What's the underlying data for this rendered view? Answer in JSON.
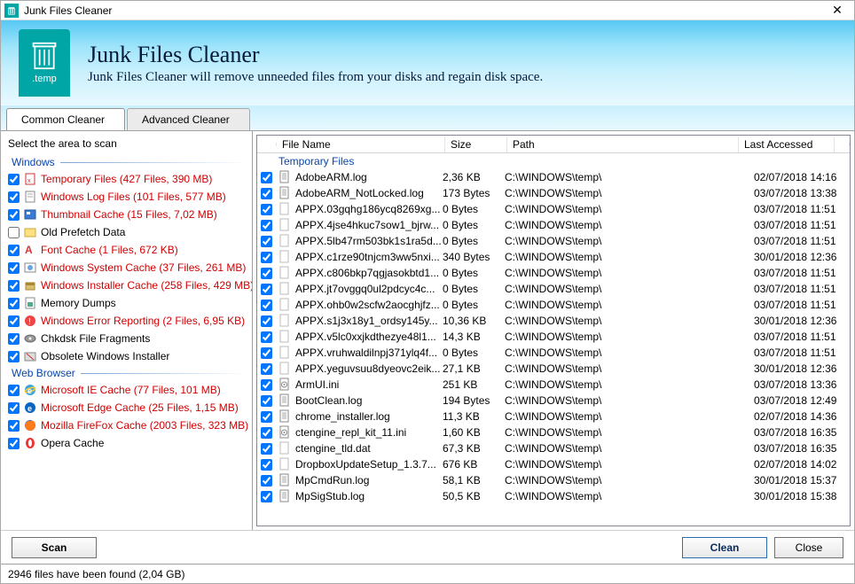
{
  "window": {
    "title": "Junk Files Cleaner"
  },
  "header": {
    "title": "Junk Files Cleaner",
    "subtitle": "Junk Files Cleaner will remove unneeded files from your disks and regain disk space.",
    "ext": ".temp"
  },
  "tabs": [
    {
      "label": "Common Cleaner",
      "active": true
    },
    {
      "label": "Advanced Cleaner",
      "active": false
    }
  ],
  "left": {
    "title": "Select the area to scan",
    "groups": [
      {
        "name": "Windows",
        "items": [
          {
            "label": "Temporary Files (427 Files, 390 MB)",
            "checked": true,
            "red": true,
            "icon": "temp"
          },
          {
            "label": "Windows Log Files (101 Files, 577 MB)",
            "checked": true,
            "red": true,
            "icon": "log"
          },
          {
            "label": "Thumbnail Cache (15 Files, 7,02 MB)",
            "checked": true,
            "red": true,
            "icon": "thumb"
          },
          {
            "label": "Old Prefetch Data",
            "checked": false,
            "red": false,
            "icon": "prefetch"
          },
          {
            "label": "Font Cache (1 Files, 672 KB)",
            "checked": true,
            "red": true,
            "icon": "font"
          },
          {
            "label": "Windows System Cache (37 Files, 261 MB)",
            "checked": true,
            "red": true,
            "icon": "syscache"
          },
          {
            "label": "Windows Installer Cache (258 Files, 429 MB)",
            "checked": true,
            "red": true,
            "icon": "installer"
          },
          {
            "label": "Memory Dumps",
            "checked": true,
            "red": false,
            "icon": "memdump"
          },
          {
            "label": "Windows Error Reporting (2 Files, 6,95 KB)",
            "checked": true,
            "red": true,
            "icon": "error"
          },
          {
            "label": "Chkdsk File Fragments",
            "checked": true,
            "red": false,
            "icon": "chkdsk"
          },
          {
            "label": "Obsolete Windows Installer",
            "checked": true,
            "red": false,
            "icon": "obsolete"
          }
        ]
      },
      {
        "name": "Web Browser",
        "items": [
          {
            "label": "Microsoft IE Cache (77 Files, 101 MB)",
            "checked": true,
            "red": true,
            "icon": "ie"
          },
          {
            "label": "Microsoft Edge Cache (25 Files, 1,15 MB)",
            "checked": true,
            "red": true,
            "icon": "edge"
          },
          {
            "label": "Mozilla FireFox Cache (2003 Files, 323 MB)",
            "checked": true,
            "red": true,
            "icon": "firefox"
          },
          {
            "label": "Opera Cache",
            "checked": true,
            "red": false,
            "icon": "opera"
          }
        ]
      }
    ]
  },
  "table": {
    "columns": {
      "name": "File Name",
      "size": "Size",
      "path": "Path",
      "date": "Last Accessed"
    },
    "group_label": "Temporary Files",
    "rows": [
      {
        "name": "AdobeARM.log",
        "size": "2,36 KB",
        "path": "C:\\WINDOWS\\temp\\",
        "date": "02/07/2018 14:16",
        "icon": "txt"
      },
      {
        "name": "AdobeARM_NotLocked.log",
        "size": "173 Bytes",
        "path": "C:\\WINDOWS\\temp\\",
        "date": "03/07/2018 13:38",
        "icon": "txt"
      },
      {
        "name": "APPX.03gqhg186ycq8269xg...",
        "size": "0 Bytes",
        "path": "C:\\WINDOWS\\temp\\",
        "date": "03/07/2018 11:51",
        "icon": "blank"
      },
      {
        "name": "APPX.4jse4hkuc7sow1_bjrw...",
        "size": "0 Bytes",
        "path": "C:\\WINDOWS\\temp\\",
        "date": "03/07/2018 11:51",
        "icon": "blank"
      },
      {
        "name": "APPX.5lb47rm503bk1s1ra5d...",
        "size": "0 Bytes",
        "path": "C:\\WINDOWS\\temp\\",
        "date": "03/07/2018 11:51",
        "icon": "blank"
      },
      {
        "name": "APPX.c1rze90tnjcm3ww5nxi...",
        "size": "340 Bytes",
        "path": "C:\\WINDOWS\\temp\\",
        "date": "30/01/2018 12:36",
        "icon": "blank"
      },
      {
        "name": "APPX.c806bkp7qgjasokbtd1...",
        "size": "0 Bytes",
        "path": "C:\\WINDOWS\\temp\\",
        "date": "03/07/2018 11:51",
        "icon": "blank"
      },
      {
        "name": "APPX.jt7ovggq0ul2pdcyc4c...",
        "size": "0 Bytes",
        "path": "C:\\WINDOWS\\temp\\",
        "date": "03/07/2018 11:51",
        "icon": "blank"
      },
      {
        "name": "APPX.ohb0w2scfw2aocghjfz...",
        "size": "0 Bytes",
        "path": "C:\\WINDOWS\\temp\\",
        "date": "03/07/2018 11:51",
        "icon": "blank"
      },
      {
        "name": "APPX.s1j3x18y1_ordsy145y...",
        "size": "10,36 KB",
        "path": "C:\\WINDOWS\\temp\\",
        "date": "30/01/2018 12:36",
        "icon": "blank"
      },
      {
        "name": "APPX.v5lc0xxjkdthezye48l1...",
        "size": "14,3 KB",
        "path": "C:\\WINDOWS\\temp\\",
        "date": "03/07/2018 11:51",
        "icon": "blank"
      },
      {
        "name": "APPX.vruhwaldilnpj371ylq4f...",
        "size": "0 Bytes",
        "path": "C:\\WINDOWS\\temp\\",
        "date": "03/07/2018 11:51",
        "icon": "blank"
      },
      {
        "name": "APPX.yeguvsuu8dyeovc2eik...",
        "size": "27,1 KB",
        "path": "C:\\WINDOWS\\temp\\",
        "date": "30/01/2018 12:36",
        "icon": "blank"
      },
      {
        "name": "ArmUI.ini",
        "size": "251 KB",
        "path": "C:\\WINDOWS\\temp\\",
        "date": "03/07/2018 13:36",
        "icon": "ini"
      },
      {
        "name": "BootClean.log",
        "size": "194 Bytes",
        "path": "C:\\WINDOWS\\temp\\",
        "date": "03/07/2018 12:49",
        "icon": "txt"
      },
      {
        "name": "chrome_installer.log",
        "size": "11,3 KB",
        "path": "C:\\WINDOWS\\temp\\",
        "date": "02/07/2018 14:36",
        "icon": "txt"
      },
      {
        "name": "ctengine_repl_kit_11.ini",
        "size": "1,60 KB",
        "path": "C:\\WINDOWS\\temp\\",
        "date": "03/07/2018 16:35",
        "icon": "ini"
      },
      {
        "name": "ctengine_tld.dat",
        "size": "67,3 KB",
        "path": "C:\\WINDOWS\\temp\\",
        "date": "03/07/2018 16:35",
        "icon": "blank"
      },
      {
        "name": "DropboxUpdateSetup_1.3.7...",
        "size": "676 KB",
        "path": "C:\\WINDOWS\\temp\\",
        "date": "02/07/2018 14:02",
        "icon": "blank"
      },
      {
        "name": "MpCmdRun.log",
        "size": "58,1 KB",
        "path": "C:\\WINDOWS\\temp\\",
        "date": "30/01/2018 15:37",
        "icon": "txt"
      },
      {
        "name": "MpSigStub.log",
        "size": "50,5 KB",
        "path": "C:\\WINDOWS\\temp\\",
        "date": "30/01/2018 15:38",
        "icon": "txt"
      }
    ]
  },
  "buttons": {
    "scan": "Scan",
    "clean": "Clean",
    "close": "Close"
  },
  "status": "2946  files have been found (2,04 GB)"
}
